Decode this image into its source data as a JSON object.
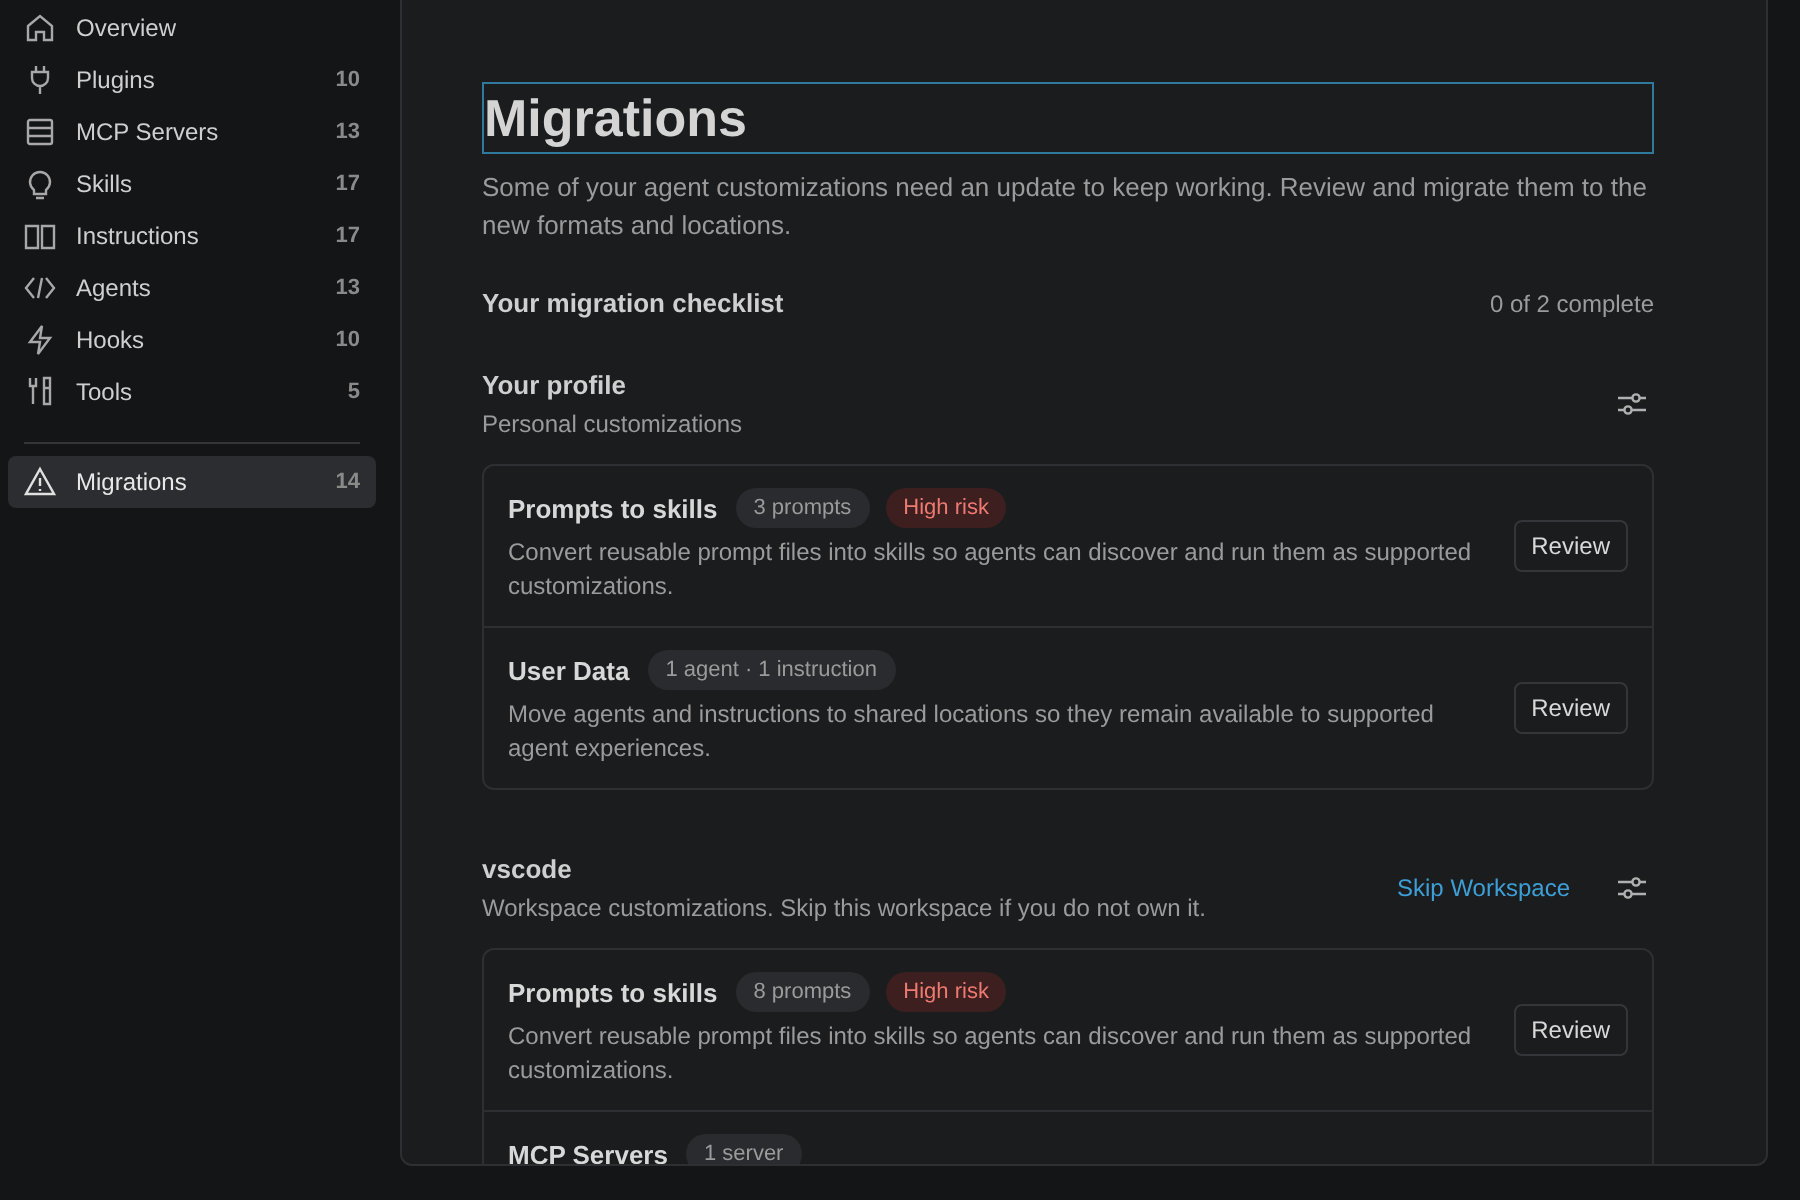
{
  "sidebar": {
    "items": [
      {
        "label": "Overview",
        "selected": false
      },
      {
        "label": "Plugins",
        "count": "10",
        "selected": false
      },
      {
        "label": "MCP Servers",
        "count": "13",
        "selected": false
      },
      {
        "label": "Skills",
        "count": "17",
        "selected": false
      },
      {
        "label": "Instructions",
        "count": "17",
        "selected": false
      },
      {
        "label": "Agents",
        "count": "13",
        "selected": false
      },
      {
        "label": "Hooks",
        "count": "10",
        "selected": false
      },
      {
        "label": "Tools",
        "count": "5",
        "selected": false
      }
    ],
    "footer_items": [
      {
        "label": "Migrations",
        "count": "14",
        "selected": true
      }
    ]
  },
  "main": {
    "title": "Migrations",
    "description": "Some of your agent customizations need an update to keep working. Review and migrate them to the new formats and locations.",
    "checklist": {
      "title": "Your migration checklist",
      "summary": "0 of 2 complete"
    },
    "sections": [
      {
        "title": "Your profile",
        "subtitle": "Personal customizations",
        "items": [
          {
            "title": "Prompts to skills",
            "badges": [
              {
                "text": "3 prompts",
                "kind": "count"
              },
              {
                "text": "High risk",
                "kind": "risk"
              }
            ],
            "description": "Convert reusable prompt files into skills so agents can discover and run them as supported customizations.",
            "action": "Review"
          },
          {
            "title": "User Data",
            "badges": [
              {
                "text": "1 agent · 1 instruction",
                "kind": "count"
              }
            ],
            "description": "Move agents and instructions to shared locations so they remain available to supported agent experiences.",
            "action": "Review"
          }
        ]
      },
      {
        "title": "vscode",
        "subtitle": "Workspace customizations. Skip this workspace if you do not own it.",
        "link": "Skip Workspace",
        "items": [
          {
            "title": "Prompts to skills",
            "badges": [
              {
                "text": "8 prompts",
                "kind": "count"
              },
              {
                "text": "High risk",
                "kind": "risk"
              }
            ],
            "description": "Convert reusable prompt files into skills so agents can discover and run them as supported customizations.",
            "action": "Review"
          },
          {
            "title": "MCP Servers",
            "badges": [
              {
                "text": "1 server",
                "kind": "count"
              }
            ]
          }
        ]
      }
    ]
  }
}
